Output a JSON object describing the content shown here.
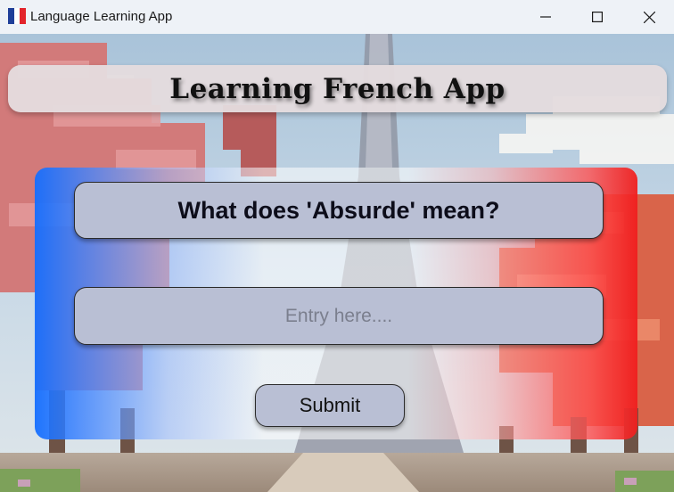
{
  "window": {
    "title": "Language Learning App",
    "icon": "french-flag-icon",
    "controls": [
      "minimize-icon",
      "maximize-icon",
      "close-icon"
    ]
  },
  "header": {
    "title": "Learning French App"
  },
  "quiz": {
    "question": "What does 'Absurde' mean?",
    "answer_placeholder": "Entry here....",
    "answer_value": "",
    "submit_label": "Submit"
  },
  "colors": {
    "flag_blue": "#1f3f99",
    "flag_white": "#ffffff",
    "flag_red": "#e3242b",
    "card_left": "#146eff",
    "card_right": "#f01e1e",
    "field_bg": "#b9bfd4",
    "header_bg": "#e4dcde"
  }
}
